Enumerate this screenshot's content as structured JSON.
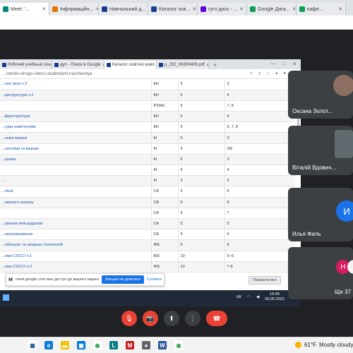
{
  "outer_tabs": [
    {
      "label": "Meet: '...",
      "icon": "meet-icon",
      "color": "#00897b",
      "active": true
    },
    {
      "label": "Інформаційн...",
      "icon": "doc-icon",
      "color": "#e37400",
      "active": false
    },
    {
      "label": "Навчальний д...",
      "icon": "moodle-icon",
      "color": "#1a3c8f",
      "active": false
    },
    {
      "label": "Каталог осв...",
      "icon": "moodle-icon",
      "color": "#1a3c8f",
      "active": false
    },
    {
      "label": "гугл диск - ...",
      "icon": "yahoo-icon",
      "color": "#6001d2",
      "active": false
    },
    {
      "label": "Google Диск...",
      "icon": "drive-icon",
      "color": "#0f9d58",
      "active": false
    },
    {
      "label": "кафе...",
      "icon": "drive-icon",
      "color": "#0f9d58",
      "active": false
    }
  ],
  "inner_browser": {
    "tabs": [
      {
        "label": "Робочий учебный пла...",
        "active": false
      },
      {
        "label": "дуп - Поиск в Google",
        "active": false
      },
      {
        "label": "Каталог освітніх комп...",
        "active": true
      },
      {
        "label": "p_292_96309406.pdf",
        "active": false
      }
    ],
    "plus": "+",
    "url": "...mentiv-vinogo-viboru-studentami-navchannya"
  },
  "courses": [
    {
      "name": "...ння Java ч.2",
      "dept": "КН",
      "credits": "5",
      "semester": "3"
    },
    {
      "name": "...раструктура ч.2",
      "dept": "КН",
      "credits": "5",
      "semester": "4"
    },
    {
      "name": "",
      "dept": "ІПЗАС",
      "credits": "5",
      "semester": "7, 8"
    },
    {
      "name": "...фраструктура",
      "dept": "КН",
      "credits": "5",
      "semester": "4"
    },
    {
      "name": "...тури комп'ютерів",
      "dept": "КН",
      "credits": "5",
      "semester": "6, 7, 8"
    },
    {
      "name": "...оніки мереж",
      "dept": "КІ",
      "credits": "5",
      "semester": "3"
    },
    {
      "name": "...системи та мережі",
      "dept": "КІ",
      "credits": "5",
      "semester": "3/5"
    },
    {
      "name": "...роніки",
      "dept": "КІ",
      "credits": "5",
      "semester": "3"
    },
    {
      "name": "",
      "dept": "КІ",
      "credits": "5",
      "semester": "4"
    },
    {
      "name": "...",
      "dept": "КІ",
      "credits": "3",
      "semester": "5"
    },
    {
      "name": "...ntext",
      "dept": "СА",
      "credits": "5",
      "semester": "6"
    },
    {
      "name": "...ованого аналізу",
      "dept": "СА",
      "credits": "5",
      "semester": "6"
    },
    {
      "name": "",
      "dept": "СА",
      "credits": "5",
      "semester": "7"
    },
    {
      "name": "...ування web-додатків",
      "dept": "СА",
      "credits": "5",
      "semester": "5"
    },
    {
      "name": "...програмування",
      "dept": "СА",
      "credits": "5",
      "semester": "6"
    },
    {
      "name": "...обільних та хмарних технологій",
      "dept": "ІКБ",
      "credits": "5",
      "semester": "6"
    },
    {
      "name": "...еми CISCO ч.1",
      "dept": "ІКБ",
      "credits": "10",
      "semester": "5–6"
    },
    {
      "name": "...еми CISCO ч.2",
      "dept": "ІКБ",
      "credits": "10",
      "semester": "7-8"
    }
  ],
  "share_notice": {
    "message": "meet.google.com має доступ до вашого екрана",
    "stop_label": "Більше не ділитися",
    "hide_label": "Сховати"
  },
  "show_all_label": "Показати все",
  "inner_taskbar": {
    "lang": "UK",
    "time": "16:49",
    "date": "06.05.2022"
  },
  "participants": [
    {
      "name": "Оксана Золот...",
      "kind": "photo"
    },
    {
      "name": "Віталій Вдович...",
      "kind": "photo"
    },
    {
      "name": "Илья Филь",
      "initial": "И",
      "color": "#1a73e8"
    },
    {
      "name": "Ще 37",
      "initial": "Н",
      "color": "#d81b60"
    }
  ],
  "controls": [
    {
      "name": "mic-off",
      "symbol": "🎙"
    },
    {
      "name": "camera-off",
      "symbol": "📷"
    },
    {
      "name": "present",
      "symbol": "⬆"
    },
    {
      "name": "more",
      "symbol": "⋮"
    },
    {
      "name": "hang-up",
      "symbol": "☎"
    }
  ],
  "weather": {
    "temp": "61°F",
    "condition": "Mostly cloudy"
  },
  "colors": {
    "meet_bg": "#202124",
    "tile_bg": "#3c4043",
    "danger": "#ea4335",
    "accent": "#1a73e8"
  }
}
